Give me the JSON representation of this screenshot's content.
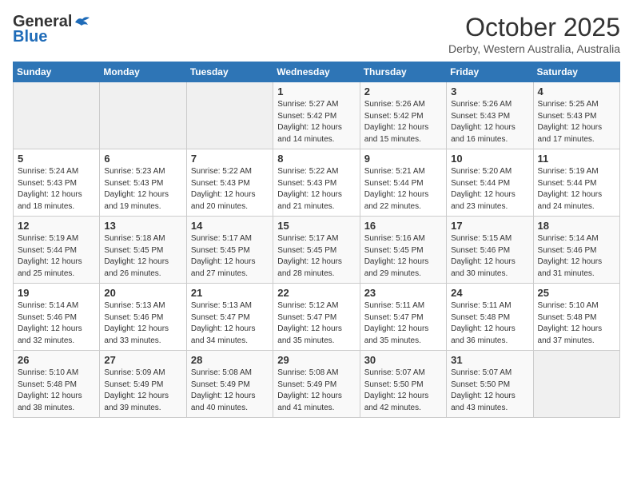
{
  "header": {
    "logo_general": "General",
    "logo_blue": "Blue",
    "month_title": "October 2025",
    "location": "Derby, Western Australia, Australia"
  },
  "weekdays": [
    "Sunday",
    "Monday",
    "Tuesday",
    "Wednesday",
    "Thursday",
    "Friday",
    "Saturday"
  ],
  "weeks": [
    [
      {
        "day": "",
        "info": ""
      },
      {
        "day": "",
        "info": ""
      },
      {
        "day": "",
        "info": ""
      },
      {
        "day": "1",
        "info": "Sunrise: 5:27 AM\nSunset: 5:42 PM\nDaylight: 12 hours\nand 14 minutes."
      },
      {
        "day": "2",
        "info": "Sunrise: 5:26 AM\nSunset: 5:42 PM\nDaylight: 12 hours\nand 15 minutes."
      },
      {
        "day": "3",
        "info": "Sunrise: 5:26 AM\nSunset: 5:43 PM\nDaylight: 12 hours\nand 16 minutes."
      },
      {
        "day": "4",
        "info": "Sunrise: 5:25 AM\nSunset: 5:43 PM\nDaylight: 12 hours\nand 17 minutes."
      }
    ],
    [
      {
        "day": "5",
        "info": "Sunrise: 5:24 AM\nSunset: 5:43 PM\nDaylight: 12 hours\nand 18 minutes."
      },
      {
        "day": "6",
        "info": "Sunrise: 5:23 AM\nSunset: 5:43 PM\nDaylight: 12 hours\nand 19 minutes."
      },
      {
        "day": "7",
        "info": "Sunrise: 5:22 AM\nSunset: 5:43 PM\nDaylight: 12 hours\nand 20 minutes."
      },
      {
        "day": "8",
        "info": "Sunrise: 5:22 AM\nSunset: 5:43 PM\nDaylight: 12 hours\nand 21 minutes."
      },
      {
        "day": "9",
        "info": "Sunrise: 5:21 AM\nSunset: 5:44 PM\nDaylight: 12 hours\nand 22 minutes."
      },
      {
        "day": "10",
        "info": "Sunrise: 5:20 AM\nSunset: 5:44 PM\nDaylight: 12 hours\nand 23 minutes."
      },
      {
        "day": "11",
        "info": "Sunrise: 5:19 AM\nSunset: 5:44 PM\nDaylight: 12 hours\nand 24 minutes."
      }
    ],
    [
      {
        "day": "12",
        "info": "Sunrise: 5:19 AM\nSunset: 5:44 PM\nDaylight: 12 hours\nand 25 minutes."
      },
      {
        "day": "13",
        "info": "Sunrise: 5:18 AM\nSunset: 5:45 PM\nDaylight: 12 hours\nand 26 minutes."
      },
      {
        "day": "14",
        "info": "Sunrise: 5:17 AM\nSunset: 5:45 PM\nDaylight: 12 hours\nand 27 minutes."
      },
      {
        "day": "15",
        "info": "Sunrise: 5:17 AM\nSunset: 5:45 PM\nDaylight: 12 hours\nand 28 minutes."
      },
      {
        "day": "16",
        "info": "Sunrise: 5:16 AM\nSunset: 5:45 PM\nDaylight: 12 hours\nand 29 minutes."
      },
      {
        "day": "17",
        "info": "Sunrise: 5:15 AM\nSunset: 5:46 PM\nDaylight: 12 hours\nand 30 minutes."
      },
      {
        "day": "18",
        "info": "Sunrise: 5:14 AM\nSunset: 5:46 PM\nDaylight: 12 hours\nand 31 minutes."
      }
    ],
    [
      {
        "day": "19",
        "info": "Sunrise: 5:14 AM\nSunset: 5:46 PM\nDaylight: 12 hours\nand 32 minutes."
      },
      {
        "day": "20",
        "info": "Sunrise: 5:13 AM\nSunset: 5:46 PM\nDaylight: 12 hours\nand 33 minutes."
      },
      {
        "day": "21",
        "info": "Sunrise: 5:13 AM\nSunset: 5:47 PM\nDaylight: 12 hours\nand 34 minutes."
      },
      {
        "day": "22",
        "info": "Sunrise: 5:12 AM\nSunset: 5:47 PM\nDaylight: 12 hours\nand 35 minutes."
      },
      {
        "day": "23",
        "info": "Sunrise: 5:11 AM\nSunset: 5:47 PM\nDaylight: 12 hours\nand 35 minutes."
      },
      {
        "day": "24",
        "info": "Sunrise: 5:11 AM\nSunset: 5:48 PM\nDaylight: 12 hours\nand 36 minutes."
      },
      {
        "day": "25",
        "info": "Sunrise: 5:10 AM\nSunset: 5:48 PM\nDaylight: 12 hours\nand 37 minutes."
      }
    ],
    [
      {
        "day": "26",
        "info": "Sunrise: 5:10 AM\nSunset: 5:48 PM\nDaylight: 12 hours\nand 38 minutes."
      },
      {
        "day": "27",
        "info": "Sunrise: 5:09 AM\nSunset: 5:49 PM\nDaylight: 12 hours\nand 39 minutes."
      },
      {
        "day": "28",
        "info": "Sunrise: 5:08 AM\nSunset: 5:49 PM\nDaylight: 12 hours\nand 40 minutes."
      },
      {
        "day": "29",
        "info": "Sunrise: 5:08 AM\nSunset: 5:49 PM\nDaylight: 12 hours\nand 41 minutes."
      },
      {
        "day": "30",
        "info": "Sunrise: 5:07 AM\nSunset: 5:50 PM\nDaylight: 12 hours\nand 42 minutes."
      },
      {
        "day": "31",
        "info": "Sunrise: 5:07 AM\nSunset: 5:50 PM\nDaylight: 12 hours\nand 43 minutes."
      },
      {
        "day": "",
        "info": ""
      }
    ]
  ]
}
